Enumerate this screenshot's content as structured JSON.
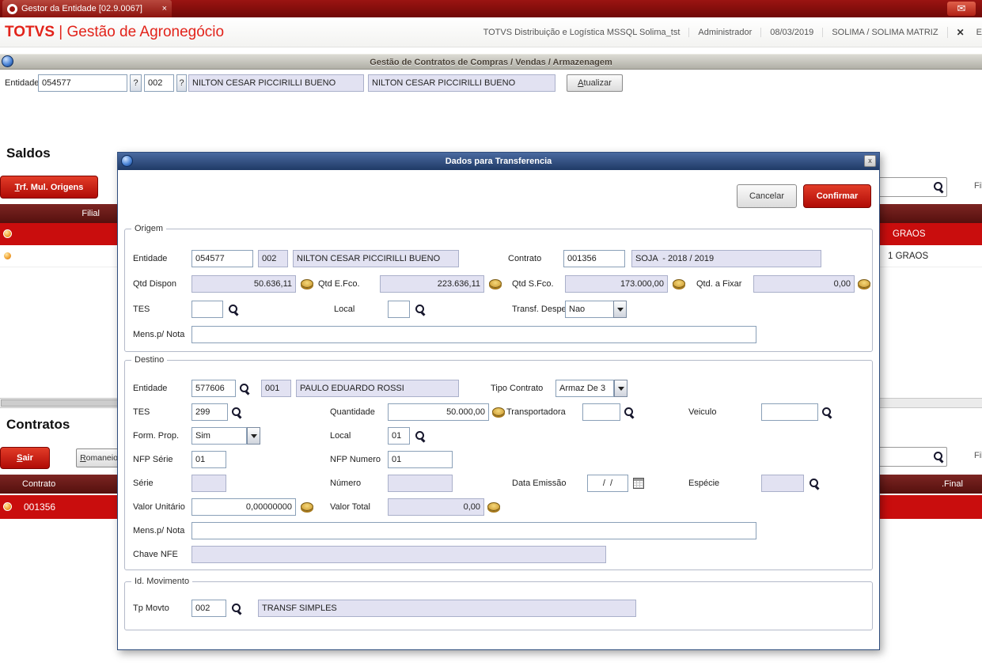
{
  "taskbar": {
    "tab_title": "Gestor da Entidade [02.9.0067]",
    "tab_close": "×",
    "mail_icon": "✉"
  },
  "header": {
    "brand_name": "TOTVS",
    "brand_divider": "|",
    "brand_product": "Gestão de Agronegócio",
    "environment": "TOTVS Distribuição e Logística MSSQL Solima_tst",
    "user": "Administrador",
    "date": "08/03/2019",
    "company": "SOLIMA / SOLIMA MATRIZ",
    "close_glyph": "✕",
    "partial_glyph": "E"
  },
  "function_bar": {
    "title": "Gestão de Contratos de Compras / Vendas / Armazenagem"
  },
  "entity_bar": {
    "label": "Entidade",
    "code": "054577",
    "help1": "?",
    "store": "002",
    "help2": "?",
    "name": "NILTON CESAR PICCIRILLI BUENO",
    "name2": "NILTON CESAR PICCIRILLI BUENO",
    "refresh_button": "Atualizar"
  },
  "saldos": {
    "title": "Saldos",
    "trf_button": "Trf. Mul. Origens",
    "filter_label": "Fil",
    "header_filial": "Filial",
    "row1_product": "GRAOS",
    "row2_product": "1 GRAOS"
  },
  "contratos": {
    "title": "Contratos",
    "sair_button": "Sair",
    "romaneio_button": "Romaneio",
    "filter_label": "Fil",
    "header_contrato": "Contrato",
    "header_final": ".Final",
    "row1_contrato": "001356"
  },
  "modal": {
    "title": "Dados para Transferencia",
    "close_glyph": "x",
    "cancel_button": "Cancelar",
    "confirm_button": "Confirmar",
    "origem": {
      "legend": "Origem",
      "entidade_label": "Entidade",
      "entidade": "054577",
      "loja": "002",
      "nome": "NILTON CESAR PICCIRILLI BUENO",
      "contrato_label": "Contrato",
      "contrato": "001356",
      "contrato_desc": "SOJA  - 2018 / 2019",
      "qtd_dispon_label": "Qtd Dispon",
      "qtd_dispon": "50.636,11",
      "qtd_efco_label": "Qtd E.Fco.",
      "qtd_efco": "223.636,11",
      "qtd_sfco_label": "Qtd S.Fco.",
      "qtd_sfco": "173.000,00",
      "qtd_fixar_label": "Qtd. a Fixar",
      "qtd_fixar": "0,00",
      "tes_label": "TES",
      "tes": "",
      "local_label": "Local",
      "local": "",
      "transf_despesa_label": "Transf. Despesa",
      "transf_despesa": "Nao",
      "mens_label": "Mens.p/ Nota",
      "mens": ""
    },
    "destino": {
      "legend": "Destino",
      "entidade_label": "Entidade",
      "entidade": "577606",
      "loja": "001",
      "nome": "PAULO EDUARDO ROSSI",
      "tipo_contrato_label": "Tipo Contrato",
      "tipo_contrato": "Armaz De 3",
      "tes_label": "TES",
      "tes": "299",
      "quantidade_label": "Quantidade",
      "quantidade": "50.000,00",
      "transportadora_label": "Transportadora",
      "transportadora": "",
      "veiculo_label": "Veiculo",
      "veiculo": "",
      "form_prop_label": "Form. Prop.",
      "form_prop": "Sim",
      "local_label": "Local",
      "local": "01",
      "nfp_serie_label": "NFP Série",
      "nfp_serie": "01",
      "nfp_numero_label": "NFP Numero",
      "nfp_numero": "01",
      "serie_label": "Série",
      "serie": "",
      "numero_label": "Número",
      "numero": "",
      "data_emissao_label": "Data Emissão",
      "data_emissao": "/  /",
      "especie_label": "Espécie",
      "especie": "",
      "valor_unitario_label": "Valor Unitário",
      "valor_unitario": "0,00000000",
      "valor_total_label": "Valor Total",
      "valor_total": "0,00",
      "mens_label": "Mens.p/ Nota",
      "mens": "",
      "chave_nfe_label": "Chave NFE",
      "chave_nfe": ""
    },
    "movimento": {
      "legend": "Id. Movimento",
      "tp_movto_label": "Tp Movto",
      "tp_movto": "002",
      "tp_movto_desc": "TRANSF SIMPLES"
    }
  }
}
